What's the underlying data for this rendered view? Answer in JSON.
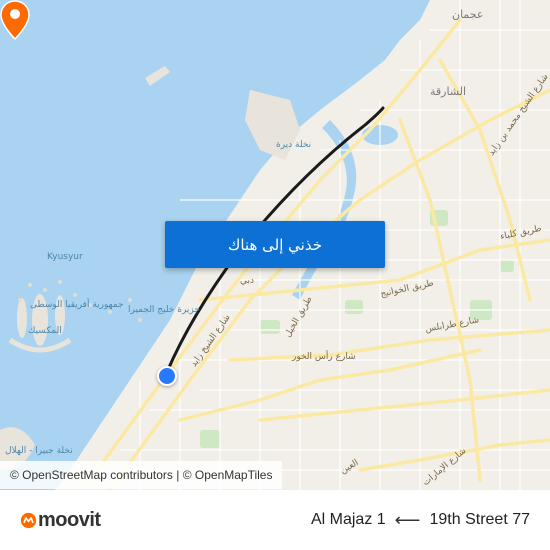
{
  "map": {
    "labels": {
      "ajman": "عجمان",
      "sharjah": "الشارقة",
      "kyusyur": "Kyusyur",
      "deira_island": "نخلة ديرة",
      "africa": "جمهورية أفريقيا الوسطى",
      "mexico": "المكسيك",
      "jumeirah_island": "جزيرة خليج الجميرا",
      "jebel_ali_palm": "نخلة جبيرا - الهلال",
      "szr": "شارع الشيخ زايد",
      "al_khail": "طريق الخيل",
      "ras_al_khor": "شارع رأس الخور",
      "al_khawaneej": "طريق الخوانيج",
      "tripoli": "شارع طرابلس",
      "kalba": "طريق كلباء",
      "mbz": "شارع الشيخ محمد بن زايد",
      "emirates": "شارع الإمارات",
      "al_ain": "العين",
      "dubai": "دبي"
    },
    "cta_label": "خذني إلى هناك",
    "attribution": "© OpenStreetMap contributors | © OpenMapTiles",
    "colors": {
      "water": "#a9d3f0",
      "land": "#f2efe9",
      "road_major": "#fbe9a3",
      "route": "#1b1b1b",
      "cta": "#0c70d4",
      "origin": "#2979ff",
      "destination": "#ff6a00"
    },
    "origin_icon": "origin-dot-icon",
    "destination_icon": "destination-pin-icon"
  },
  "footer": {
    "brand": "moovit",
    "destination": "Al Majaz 1",
    "origin": "19th Street 77",
    "arrow": "⟵"
  }
}
